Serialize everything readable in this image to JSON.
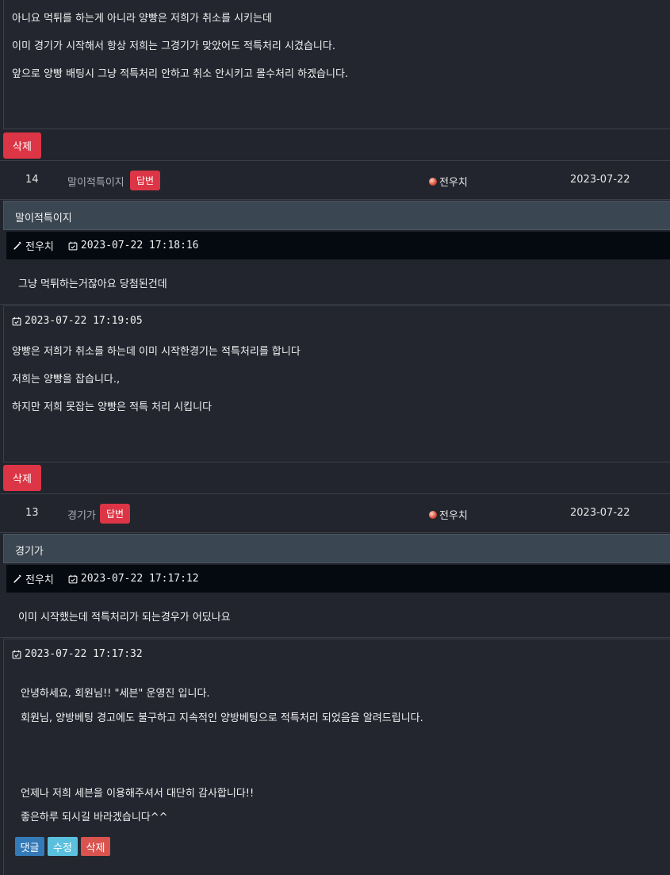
{
  "top_post": {
    "lines": [
      "아니요 먹튀를 하는게 아니라 양빵은 저희가 취소를 시키는데",
      "이미 경기가 시작해서 항상 저희는 그경기가 맞았어도 적특처리 시겼습니다.",
      "앞으로 양빵 배팅시 그냥 적특처리 안하고 취소 안시키고 몰수처리 하겠습니다."
    ],
    "delete_label": "삭제"
  },
  "posts": [
    {
      "number": "14",
      "subject": "말이적특이지",
      "reply_badge": "답변",
      "author": "전우치",
      "date": "2023-07-22",
      "panel_title": "말이적특이지",
      "meta_author": "전우치",
      "meta_datetime": "2023-07-22 17:18:16",
      "question": "그냥 먹튀하는거잖아요 당첨된건데",
      "answer_datetime": "2023-07-22 17:19:05",
      "answer_lines": [
        "양빵은 저희가 취소를 하는데 이미 시작한경기는 적특처리를 합니다",
        "저희는 양빵을 잡습니다.,",
        "하지만 저희 못잡는 양빵은 적특 처리 시킵니다"
      ],
      "delete_label": "삭제"
    },
    {
      "number": "13",
      "subject": "경기가",
      "reply_badge": "답변",
      "author": "전우치",
      "date": "2023-07-22",
      "panel_title": "경기가",
      "meta_author": "전우치",
      "meta_datetime": "2023-07-22 17:17:12",
      "question": "이미 시작했는데 적특처리가 되는경우가 어딨나요",
      "answer_datetime": "2023-07-22 17:17:32",
      "answer_lines": [
        "안녕하세요, 회원님!!  \"세븐\" 운영진 입니다.",
        "회원님, 양방베팅 경고에도 불구하고 지속적인 양방베팅으로 적특처리 되었음을 알려드립니다.",
        "언제나 저희 세븐을 이용해주셔서 대단히 감사합니다!!",
        "좋은하루 되시길 바라겠습니다^^"
      ],
      "buttons": {
        "comment": "댓글",
        "edit": "수정",
        "delete": "삭제"
      }
    }
  ],
  "colors": {
    "background": "#22252e",
    "danger": "#dc3545",
    "panel_header": "#3a4651",
    "meta_bar": "#050a10",
    "primary": "#337ab7",
    "info": "#5bc0de",
    "danger_alt": "#d9534f"
  },
  "icons": {
    "author": "pencil-icon",
    "date": "calendar-check-icon",
    "author_level": "orange-dot-icon"
  }
}
